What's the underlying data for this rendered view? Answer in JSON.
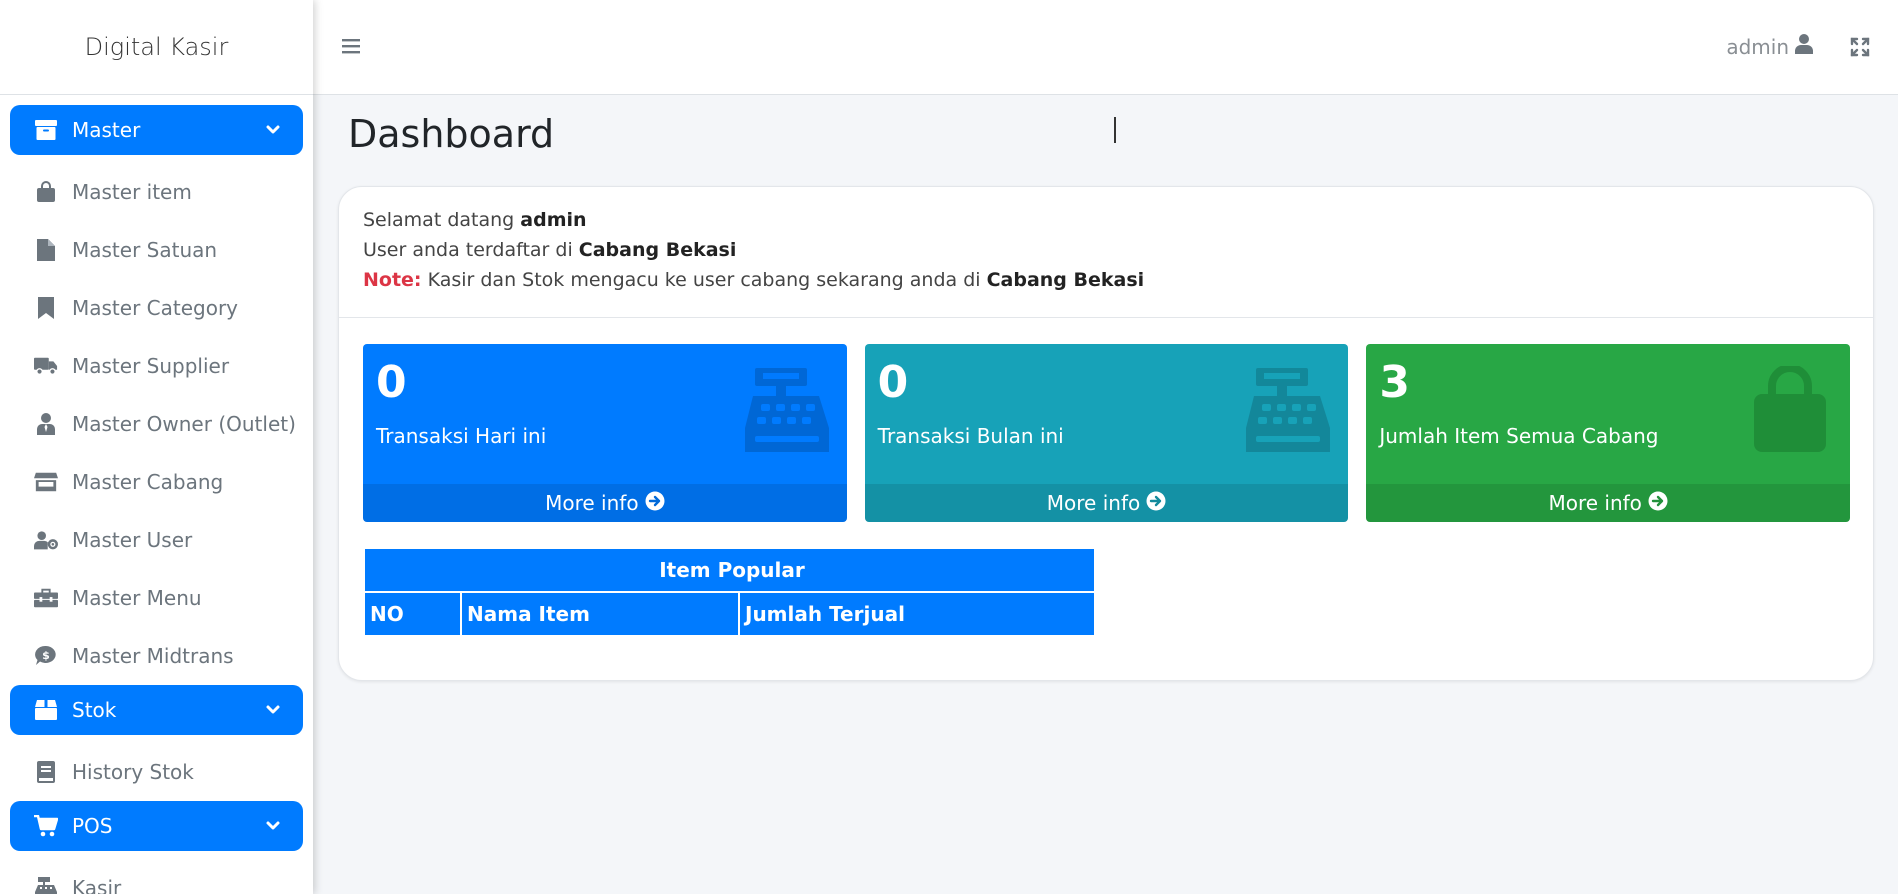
{
  "brand": "Digital Kasir",
  "sidebar": {
    "groups": [
      {
        "label": "Master",
        "icon": "archive-icon"
      },
      {
        "label": "Stok",
        "icon": "box-icon"
      },
      {
        "label": "POS",
        "icon": "cart-icon"
      }
    ],
    "master_items": [
      {
        "label": "Master item",
        "icon": "shopping-bag-icon"
      },
      {
        "label": "Master Satuan",
        "icon": "file-icon"
      },
      {
        "label": "Master Category",
        "icon": "bookmark-icon"
      },
      {
        "label": "Master Supplier",
        "icon": "truck-icon"
      },
      {
        "label": "Master Owner (Outlet)",
        "icon": "user-tie-icon"
      },
      {
        "label": "Master Cabang",
        "icon": "store-icon"
      },
      {
        "label": "Master User",
        "icon": "user-cog-icon"
      },
      {
        "label": "Master Menu",
        "icon": "toolbox-icon"
      },
      {
        "label": "Master Midtrans",
        "icon": "comment-dollar-icon"
      }
    ],
    "stok_items": [
      {
        "label": "History Stok",
        "icon": "book-icon"
      }
    ],
    "pos_items": [
      {
        "label": "Kasir",
        "icon": "cash-register-icon"
      }
    ]
  },
  "topbar": {
    "user": "admin"
  },
  "page_title": "Dashboard",
  "welcome": {
    "line1_prefix": "Selamat datang",
    "user": "admin",
    "line2_prefix": "User anda terdaftar di",
    "branch": "Cabang Bekasi",
    "note_label": "Note:",
    "note_text": "Kasir dan Stok mengacu ke user cabang sekarang anda di",
    "note_branch": "Cabang Bekasi"
  },
  "boxes": [
    {
      "value": "0",
      "label": "Transaksi Hari ini",
      "footer": "More info",
      "color": "#007bff",
      "icon": "cash-register-icon"
    },
    {
      "value": "0",
      "label": "Transaksi Bulan ini",
      "footer": "More info",
      "color": "#17a2b8",
      "icon": "cash-register-icon"
    },
    {
      "value": "3",
      "label": "Jumlah Item Semua Cabang",
      "footer": "More info",
      "color": "#28a745",
      "icon": "shopping-bag-icon"
    }
  ],
  "popular_table": {
    "title": "Item Popular",
    "columns": [
      "NO",
      "Nama Item",
      "Jumlah Terjual"
    ]
  }
}
